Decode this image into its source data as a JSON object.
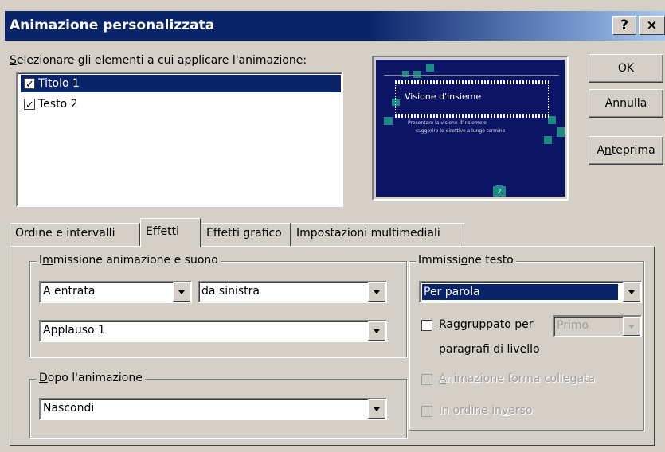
{
  "window": {
    "title": "Animazione personalizzata",
    "help_button": "?",
    "close_button": "×"
  },
  "elements": {
    "label_pre": "S",
    "label_post": "elezionare gli elementi a cui applicare l'animazione:",
    "items": [
      {
        "label": "Titolo 1",
        "checked": true,
        "selected": true
      },
      {
        "label": "Testo 2",
        "checked": true,
        "selected": false
      }
    ]
  },
  "preview": {
    "title_text": "Visione d'insieme",
    "body_line1": "Presentare la visione d'insieme e",
    "body_line2": "suggerire le direttive a lungo termine",
    "slide_number": "2",
    "slide_background": "#0c1466",
    "accent_color": "#1a8a86"
  },
  "buttons": {
    "ok": "OK",
    "cancel": "Annulla",
    "preview_pre": "A",
    "preview_u": "n",
    "preview_post": "teprima"
  },
  "tabs": [
    {
      "label": "Ordine e intervalli",
      "active": false
    },
    {
      "label": "Effetti",
      "active": true
    },
    {
      "label": "Effetti grafico",
      "active": false
    },
    {
      "label": "Impostazioni multimediali",
      "active": false
    }
  ],
  "effects": {
    "entry_group_pre": "I",
    "entry_group_u": "m",
    "entry_group_post": "missione animazione e suono",
    "effect_value": "A entrata",
    "direction_value": "da sinistra",
    "sound_value": "Applauso 1",
    "after_group_pre": "",
    "after_group_u": "D",
    "after_group_post": "opo l'animazione",
    "after_value": "Nascondi",
    "text_group_pre": "Immissi",
    "text_group_u": "o",
    "text_group_post": "ne testo",
    "text_value": "Per parola",
    "grouped_pre": "",
    "grouped_u": "R",
    "grouped_post": "aggruppato per",
    "grouped_checked": false,
    "grouped_level": "Primo",
    "paragraphs_label": "paragrafi di livello",
    "attached_pre": "",
    "attached_u": "A",
    "attached_post": "nimazione forma collegata",
    "reverse_pre": "In ordine in",
    "reverse_u": "v",
    "reverse_post": "erso"
  }
}
